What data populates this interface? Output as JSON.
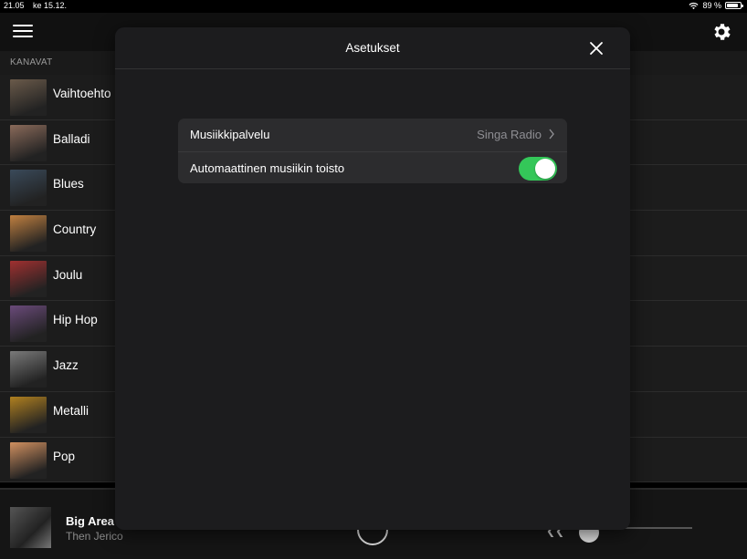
{
  "status_bar": {
    "time": "21.05",
    "date": "ke 15.12.",
    "battery": "89 %",
    "battery_level": 0.89
  },
  "section_header": "KANAVAT",
  "channels": [
    {
      "name": "Vaihtoehto",
      "color": "#6a5a4a"
    },
    {
      "name": "Balladi",
      "color": "#8a6a5a"
    },
    {
      "name": "Blues",
      "color": "#3a4a5a"
    },
    {
      "name": "Country",
      "color": "#c08040"
    },
    {
      "name": "Joulu",
      "color": "#a03030"
    },
    {
      "name": "Hip Hop",
      "color": "#6a4a7a"
    },
    {
      "name": "Jazz",
      "color": "#7a7a7a"
    },
    {
      "name": "Metalli",
      "color": "#b08020"
    },
    {
      "name": "Pop",
      "color": "#d09060"
    }
  ],
  "player": {
    "title": "Big Area",
    "artist": "Then Jerico"
  },
  "modal": {
    "title": "Asetukset",
    "rows": [
      {
        "label": "Musiikkipalvelu",
        "value": "Singa Radio"
      },
      {
        "label": "Automaattinen musiikin toisto",
        "toggle_on": true
      }
    ]
  },
  "colors": {
    "toggle_on": "#34c759",
    "modal_bg": "#1c1c1e",
    "group_bg": "#2c2c2e"
  }
}
